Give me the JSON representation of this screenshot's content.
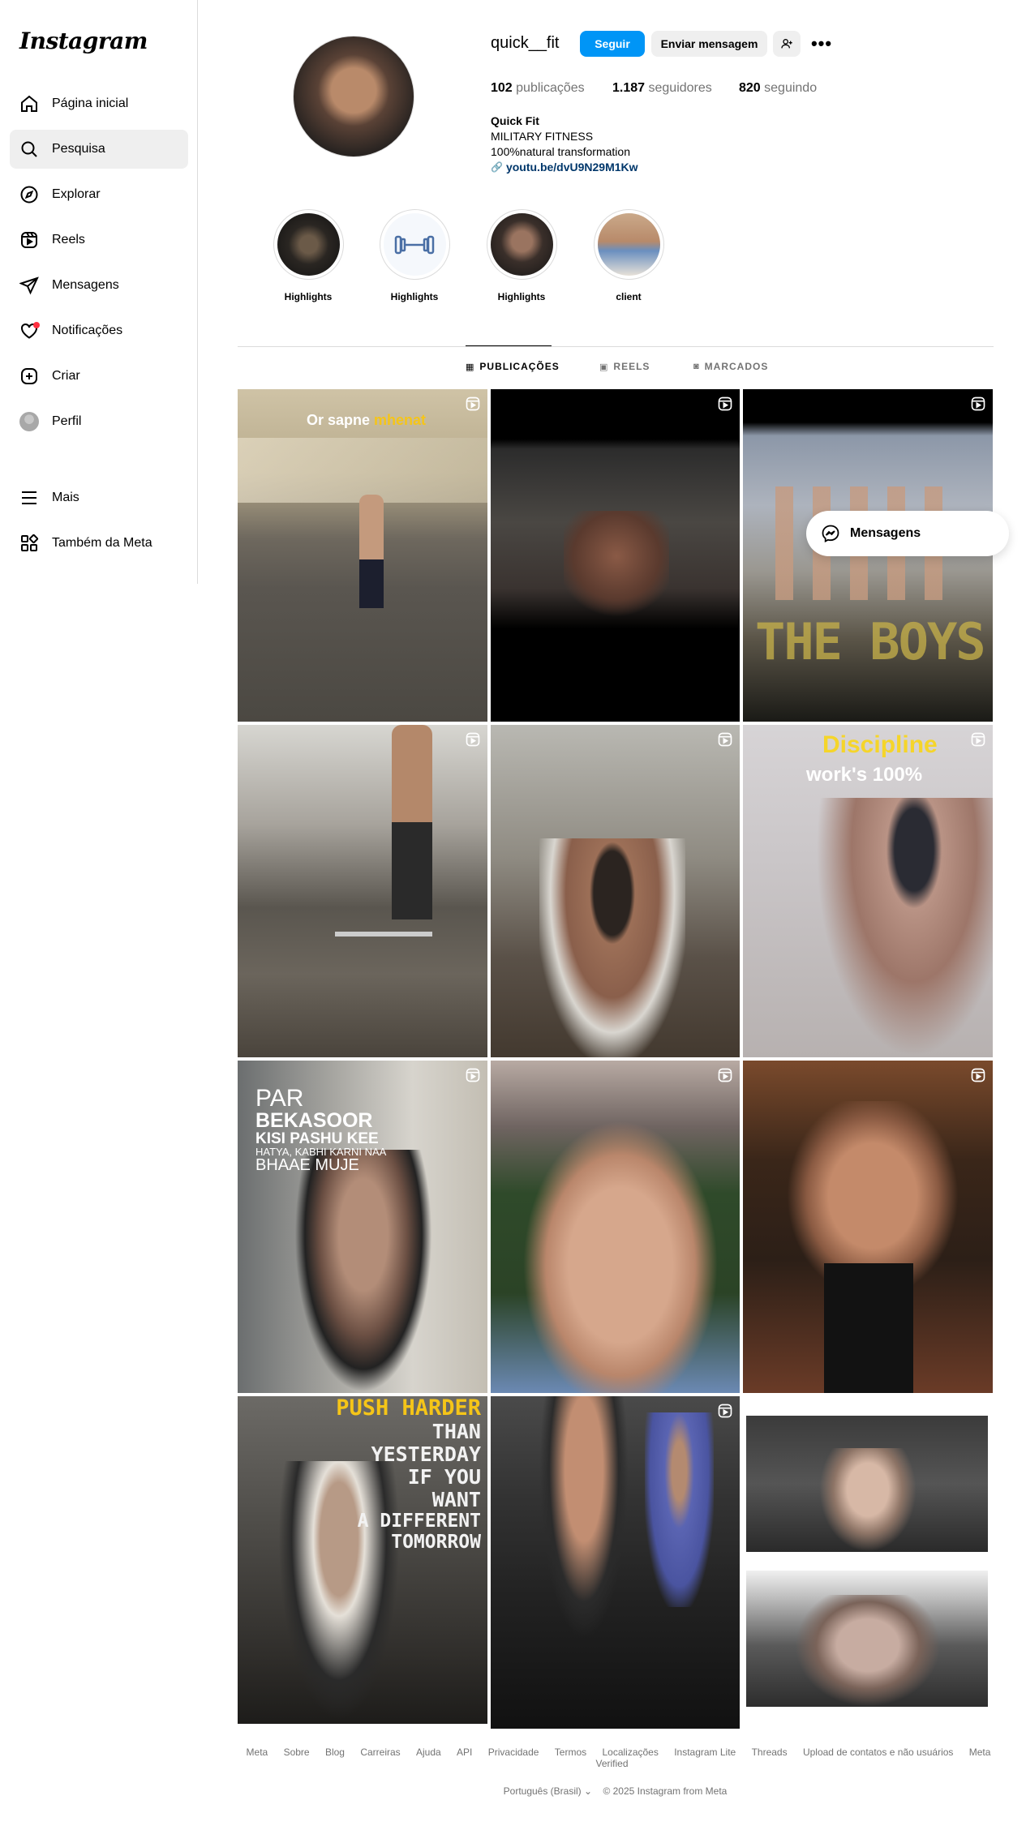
{
  "app": {
    "logo": "Instagram"
  },
  "nav": {
    "items": [
      {
        "label": "Página inicial",
        "icon": "home-icon"
      },
      {
        "label": "Pesquisa",
        "icon": "search-icon",
        "active": true
      },
      {
        "label": "Explorar",
        "icon": "compass-icon"
      },
      {
        "label": "Reels",
        "icon": "reels-icon"
      },
      {
        "label": "Mensagens",
        "icon": "direct-icon"
      },
      {
        "label": "Notificações",
        "icon": "heart-icon"
      },
      {
        "label": "Criar",
        "icon": "plus-square-icon"
      },
      {
        "label": "Perfil",
        "icon": "profile-avatar"
      }
    ],
    "more": "Mais",
    "meta": "Também da Meta"
  },
  "profile": {
    "username": "quick__fit",
    "follow_label": "Seguir",
    "message_label": "Enviar mensagem",
    "posts_count": "102",
    "posts_label": "publicações",
    "followers_count": "1.187",
    "followers_label": "seguidores",
    "following_count": "820",
    "following_label": "seguindo",
    "name": "Quick Fit",
    "bio_line1": "MILITARY FITNESS",
    "bio_line2": "100%natural transformation",
    "link": "youtu.be/dvU9N29M1Kw"
  },
  "highlights": [
    {
      "label": "Highlights"
    },
    {
      "label": "Highlights"
    },
    {
      "label": "Highlights"
    },
    {
      "label": "client"
    }
  ],
  "tabs": [
    {
      "label": "PUBLICAÇÕES",
      "active": true
    },
    {
      "label": "REELS"
    },
    {
      "label": "MARCADOS"
    }
  ],
  "posts": {
    "p1_text_a": "Or sapne",
    "p1_text_b": "mhenat",
    "p6_text_a": "Discipline",
    "p6_text_b": "work's 100%",
    "p3_text": "THE BOYS",
    "p7_lines": [
      "PAR",
      "BEKASOOR",
      "KISI PASHU KEE",
      "HATYA, KABHI KARNI NAA",
      "BHAAE MUJE"
    ],
    "p10_lines": [
      "PUSH HARDER",
      "THAN",
      "YESTERDAY",
      "IF YOU",
      "WANT",
      "A DIFFERENT",
      "TOMORROW"
    ]
  },
  "messages_float": {
    "label": "Mensagens"
  },
  "footer": {
    "links": [
      "Meta",
      "Sobre",
      "Blog",
      "Carreiras",
      "Ajuda",
      "API",
      "Privacidade",
      "Termos",
      "Localizações",
      "Instagram Lite",
      "Threads",
      "Upload de contatos e não usuários",
      "Meta Verified"
    ],
    "language": "Português (Brasil)",
    "copyright": "© 2025 Instagram from Meta"
  },
  "colors": {
    "accent": "#0095f6",
    "link": "#00376b",
    "notif": "#ff3040",
    "yellow_text": "#f5c518"
  }
}
